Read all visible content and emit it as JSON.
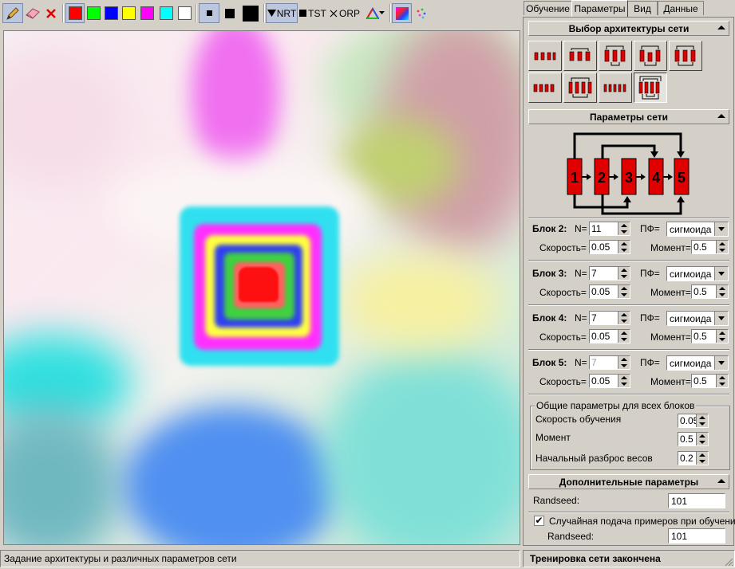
{
  "toolbar": {
    "tools": [
      "pencil-icon",
      "eraser-icon",
      "clear-icon"
    ],
    "colors": [
      "#ff0000",
      "#00ff00",
      "#0000ff",
      "#ffff00",
      "#ff00ff",
      "#00ffff",
      "#ffffff"
    ],
    "nrt_label": "NRT",
    "tst_label": "TST",
    "orp_label": "ORP"
  },
  "tabs": [
    "Обучение",
    "Параметры",
    "Вид",
    "Данные"
  ],
  "active_tab": "Параметры",
  "sections": {
    "arch_title": "Выбор архитектуры сети",
    "params_title": "Параметры сети",
    "extra_title": "Дополнительные параметры"
  },
  "diagram": {
    "blocks": [
      "1",
      "2",
      "3",
      "4",
      "5"
    ]
  },
  "block_labels": {
    "n": "N=",
    "pf": "ПФ=",
    "speed": "Скорость=",
    "moment": "Момент="
  },
  "blocks": [
    {
      "name": "Блок 2:",
      "n": "11",
      "pf": "сигмоида",
      "speed": "0.05",
      "moment": "0.5"
    },
    {
      "name": "Блок 3:",
      "n": "7",
      "pf": "сигмоида",
      "speed": "0.05",
      "moment": "0.5"
    },
    {
      "name": "Блок 4:",
      "n": "7",
      "pf": "сигмоида",
      "speed": "0.05",
      "moment": "0.5"
    },
    {
      "name": "Блок 5:",
      "n": "7",
      "pf": "сигмоида",
      "speed": "0.05",
      "moment": "0.5"
    }
  ],
  "common": {
    "title": "Общие параметры для всех блоков",
    "rate_label": "Скорость обучения",
    "rate": "0.05",
    "moment_label": "Момент",
    "moment": "0.5",
    "spread_label": "Начальный разброс весов",
    "spread": "0.2"
  },
  "extra": {
    "randseed_label": "Randseed:",
    "randseed": "101",
    "random_label": "Случайная подача примеров при обучении",
    "random_checked": true,
    "randseed2_label": "Randseed:",
    "randseed2": "101"
  },
  "status": {
    "left": "Задание архитектуры и различных параметров сети",
    "right": "Тренировка сети закончена"
  }
}
